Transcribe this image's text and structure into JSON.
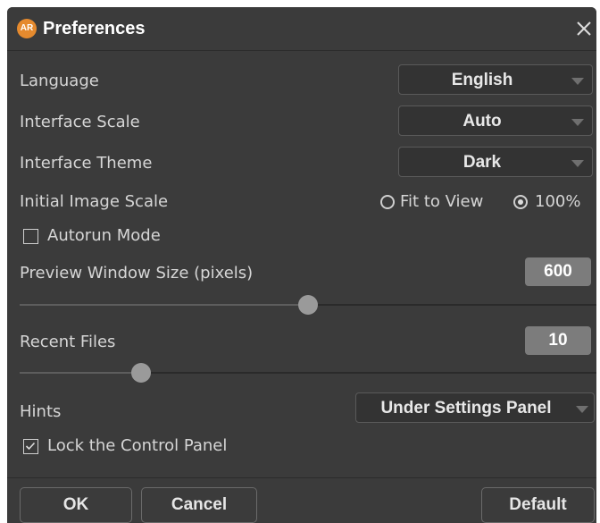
{
  "window": {
    "logo_text": "AR",
    "title": "Preferences",
    "close_icon": "close-icon"
  },
  "settings": {
    "language": {
      "label": "Language",
      "value": "English"
    },
    "interface_scale": {
      "label": "Interface Scale",
      "value": "Auto"
    },
    "interface_theme": {
      "label": "Interface Theme",
      "value": "Dark"
    },
    "initial_image_scale": {
      "label": "Initial Image Scale",
      "options": [
        "Fit to View",
        "100%"
      ],
      "selected": "100%"
    },
    "autorun_mode": {
      "label": "Autorun Mode",
      "checked": false
    },
    "preview_window_size": {
      "label": "Preview Window Size (pixels)",
      "value": "600",
      "slider_fraction": 0.5
    },
    "recent_files": {
      "label": "Recent Files",
      "value": "10",
      "slider_fraction": 0.21
    },
    "hints": {
      "label": "Hints",
      "value": "Under Settings Panel"
    },
    "lock_control_panel": {
      "label": "Lock the Control Panel",
      "checked": true
    }
  },
  "buttons": {
    "ok": "OK",
    "cancel": "Cancel",
    "default": "Default"
  },
  "colors": {
    "dialog_bg": "#3b3b3b",
    "logo_accent": "#e58a2e",
    "value_box_bg": "#7c7c7c",
    "slider_thumb": "#9a9a9a"
  }
}
